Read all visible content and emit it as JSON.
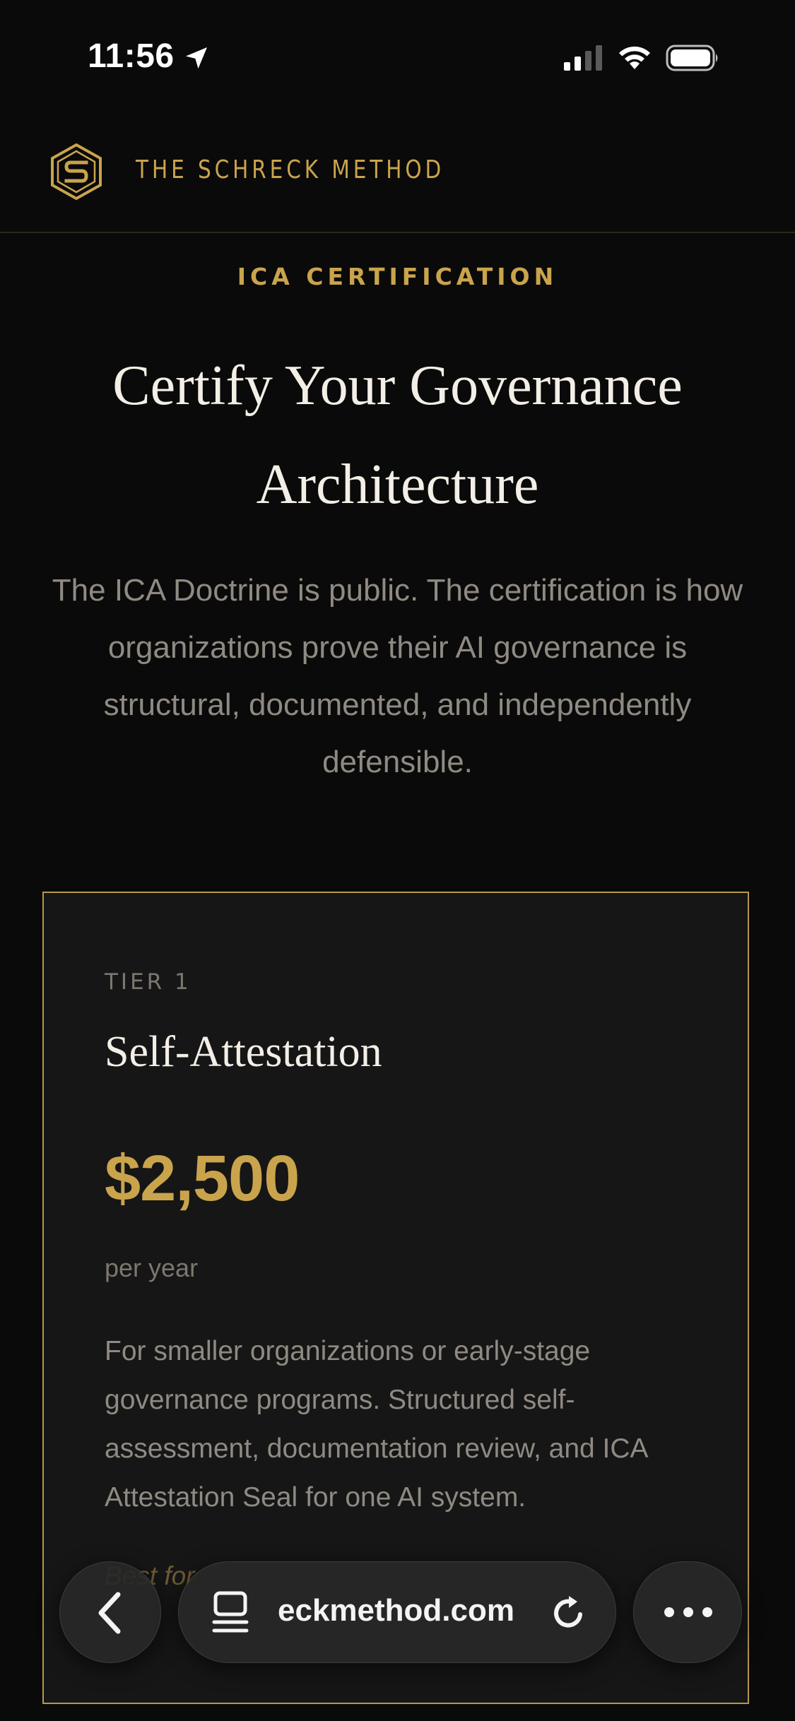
{
  "status_bar": {
    "time": "11:56",
    "icons": [
      "location-arrow-icon",
      "cellular-signal-icon",
      "wifi-icon",
      "battery-icon"
    ]
  },
  "header": {
    "brand_name": "THE SCHRECK METHOD",
    "logo_icon": "schreck-s-hexagon-logo",
    "accent_color": "#c9a44c"
  },
  "hero": {
    "eyebrow": "ICA CERTIFICATION",
    "title_line1": "Certify Your Governance",
    "title_line2": "Architecture",
    "body": "The ICA Doctrine is public. The certification is how organizations prove their AI governance is structural, documented, and independently defensible."
  },
  "tier": {
    "label": "TIER 1",
    "title": "Self-Attestation",
    "price": "$2,500",
    "period": "per year",
    "description": "For smaller organizations or early-stage governance programs. Structured self-assessment, documentation review, and ICA Attestation Seal for one AI system.",
    "best_for_partial": "Best for"
  },
  "browser": {
    "url": "eckmethod.com",
    "icons": [
      "back-chevron-icon",
      "tabs-icon",
      "reload-icon",
      "more-dots-icon"
    ]
  }
}
